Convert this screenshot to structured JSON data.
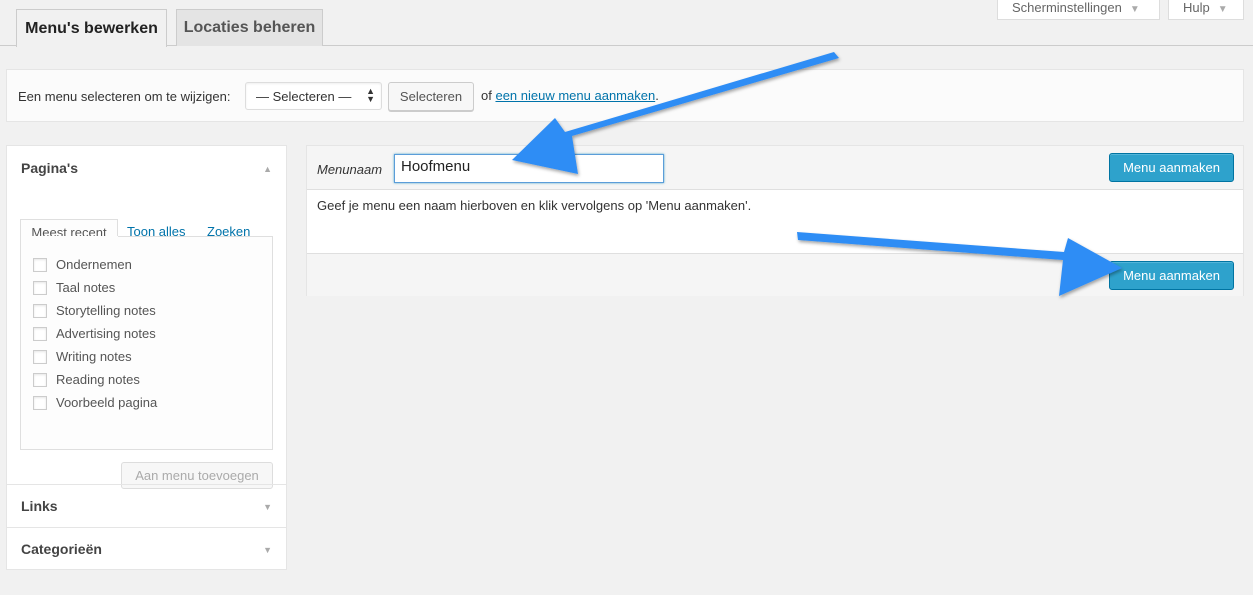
{
  "screen_meta": {
    "screen_options_label": "Scherminstellingen",
    "help_label": "Hulp"
  },
  "tabs": [
    {
      "label": "Menu's bewerken",
      "active": true
    },
    {
      "label": "Locaties beheren",
      "active": false
    }
  ],
  "manage": {
    "select_label": "Een menu selecteren om te wijzigen:",
    "select_value": "— Selecteren —",
    "select_button": "Selecteren",
    "or_text": "of",
    "new_menu_link": "een nieuw menu aanmaken",
    "period": "."
  },
  "sidebar": {
    "pages": {
      "title": "Pagina's",
      "tabs": [
        "Meest recent",
        "Toon alles",
        "Zoeken"
      ],
      "items": [
        "Ondernemen",
        "Taal notes",
        "Storytelling notes",
        "Advertising notes",
        "Writing notes",
        "Reading notes",
        "Voorbeeld pagina"
      ],
      "add_button": "Aan menu toevoegen"
    },
    "links_title": "Links",
    "categories_title": "Categorieën"
  },
  "editor": {
    "name_label": "Menunaam",
    "name_value": "Hoofmenu",
    "create_button": "Menu aanmaken",
    "hint": "Geef je menu een naam hierboven en klik vervolgens op 'Menu aanmaken'.",
    "create_button_footer": "Menu aanmaken"
  },
  "colors": {
    "primary": "#2ea2cc",
    "link": "#0073aa",
    "arrow": "#2e8df5"
  }
}
